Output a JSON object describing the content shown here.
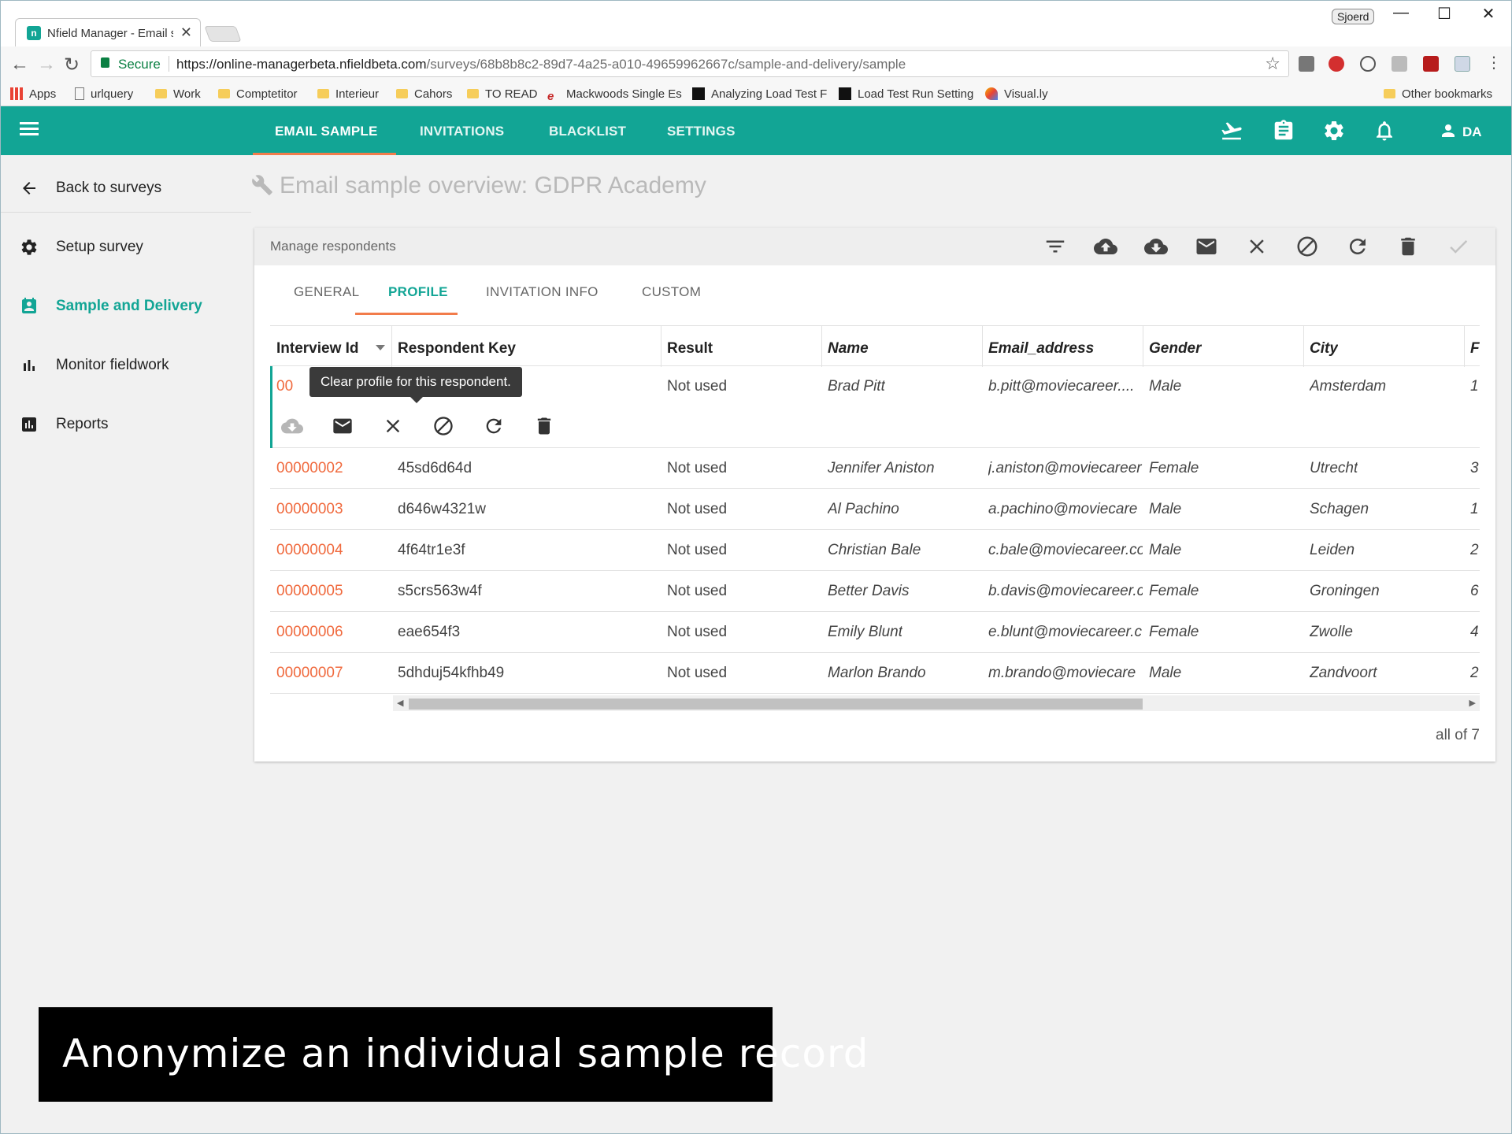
{
  "browser": {
    "tab_title": "Nfield Manager - Email s",
    "tab_close": "✕",
    "profile": "Sjoerd",
    "window_controls": [
      "—",
      "☐",
      "✕"
    ],
    "secure_label": "Secure",
    "url_host": "https://online-managerbeta.nfieldbeta.com",
    "url_path": "/surveys/68b8b8c2-89d7-4a25-a010-49659962667c/sample-and-delivery/sample",
    "bookmarks": [
      {
        "label": "Apps",
        "icon": "apps-grid-icon"
      },
      {
        "label": "urlquery",
        "icon": "page-icon"
      },
      {
        "label": "Work",
        "icon": "folder-icon"
      },
      {
        "label": "Comptetitor",
        "icon": "folder-icon"
      },
      {
        "label": "Interieur",
        "icon": "folder-icon"
      },
      {
        "label": "Cahors",
        "icon": "folder-icon"
      },
      {
        "label": "TO READ",
        "icon": "folder-icon"
      },
      {
        "label": "Mackwoods Single Es",
        "icon": "e-logo-icon"
      },
      {
        "label": "Analyzing Load Test F",
        "icon": "m-logo-icon"
      },
      {
        "label": "Load Test Run Setting",
        "icon": "m-logo-icon"
      },
      {
        "label": "Visual.ly",
        "icon": "visually-icon"
      }
    ],
    "other_bookmarks": "Other bookmarks"
  },
  "appbar": {
    "tabs": [
      {
        "label": "EMAIL SAMPLE",
        "active": true
      },
      {
        "label": "INVITATIONS",
        "active": false
      },
      {
        "label": "BLACKLIST",
        "active": false
      },
      {
        "label": "SETTINGS",
        "active": false
      }
    ],
    "user_initials": "DA",
    "icons": [
      "flight-takeoff-icon",
      "clipboard-icon",
      "gear-icon",
      "bell-icon",
      "person-icon"
    ]
  },
  "sidebar": {
    "back": "Back to surveys",
    "items": [
      {
        "label": "Setup survey",
        "icon": "gear-icon",
        "active": false
      },
      {
        "label": "Sample and Delivery",
        "icon": "contact-card-icon",
        "active": true
      },
      {
        "label": "Monitor fieldwork",
        "icon": "bar-chart-icon",
        "active": false
      },
      {
        "label": "Reports",
        "icon": "report-chart-icon",
        "active": false
      }
    ]
  },
  "main": {
    "title": "Email sample overview: GDPR Academy",
    "card_title": "Manage respondents",
    "header_actions": [
      "filter-icon",
      "cloud-upload-icon",
      "cloud-download-icon",
      "mail-icon",
      "close-icon",
      "block-icon",
      "refresh-icon",
      "trash-icon",
      "check-icon"
    ],
    "subtabs": [
      {
        "label": "GENERAL",
        "active": false
      },
      {
        "label": "PROFILE",
        "active": true
      },
      {
        "label": "INVITATION INFO",
        "active": false
      },
      {
        "label": "CUSTOM",
        "active": false
      }
    ],
    "columns": [
      "Interview Id",
      "Respondent Key",
      "Result",
      "Name",
      "Email_address",
      "Gender",
      "City",
      "F"
    ],
    "rows": [
      {
        "id": "00",
        "key": "",
        "result": "Not used",
        "name": "Brad Pitt",
        "email": "b.pitt@moviecareer....",
        "gender": "Male",
        "city": "Amsterdam",
        "extra": "1"
      },
      {
        "id": "00000002",
        "key": "45sd6d64d",
        "result": "Not used",
        "name": "Jennifer Aniston",
        "email": "j.aniston@moviecareer",
        "gender": "Female",
        "city": "Utrecht",
        "extra": "3"
      },
      {
        "id": "00000003",
        "key": "d646w4321w",
        "result": "Not used",
        "name": "Al Pachino",
        "email": "a.pachino@moviecare",
        "gender": "Male",
        "city": "Schagen",
        "extra": "1"
      },
      {
        "id": "00000004",
        "key": "4f64tr1e3f",
        "result": "Not used",
        "name": "Christian Bale",
        "email": "c.bale@moviecareer.co",
        "gender": "Male",
        "city": "Leiden",
        "extra": "2"
      },
      {
        "id": "00000005",
        "key": "s5crs563w4f",
        "result": "Not used",
        "name": "Better Davis",
        "email": "b.davis@moviecareer.c",
        "gender": "Female",
        "city": "Groningen",
        "extra": "6"
      },
      {
        "id": "00000006",
        "key": "eae654f3",
        "result": "Not used",
        "name": "Emily Blunt",
        "email": "e.blunt@moviecareer.c",
        "gender": "Female",
        "city": "Zwolle",
        "extra": "4"
      },
      {
        "id": "00000007",
        "key": "5dhduj54kfhb49",
        "result": "Not used",
        "name": "Marlon Brando",
        "email": "m.brando@moviecare",
        "gender": "Male",
        "city": "Zandvoort",
        "extra": "2"
      }
    ],
    "row_actions": [
      "cloud-download-icon",
      "mail-icon",
      "close-icon",
      "block-icon",
      "refresh-icon",
      "trash-icon"
    ],
    "tooltip": "Clear profile for this respondent.",
    "count": "all of 7"
  },
  "caption": "Anonymize an individual sample record",
  "colors": {
    "brand": "#12a595",
    "accent": "#f27c4b",
    "id_link": "#f06a3e"
  }
}
